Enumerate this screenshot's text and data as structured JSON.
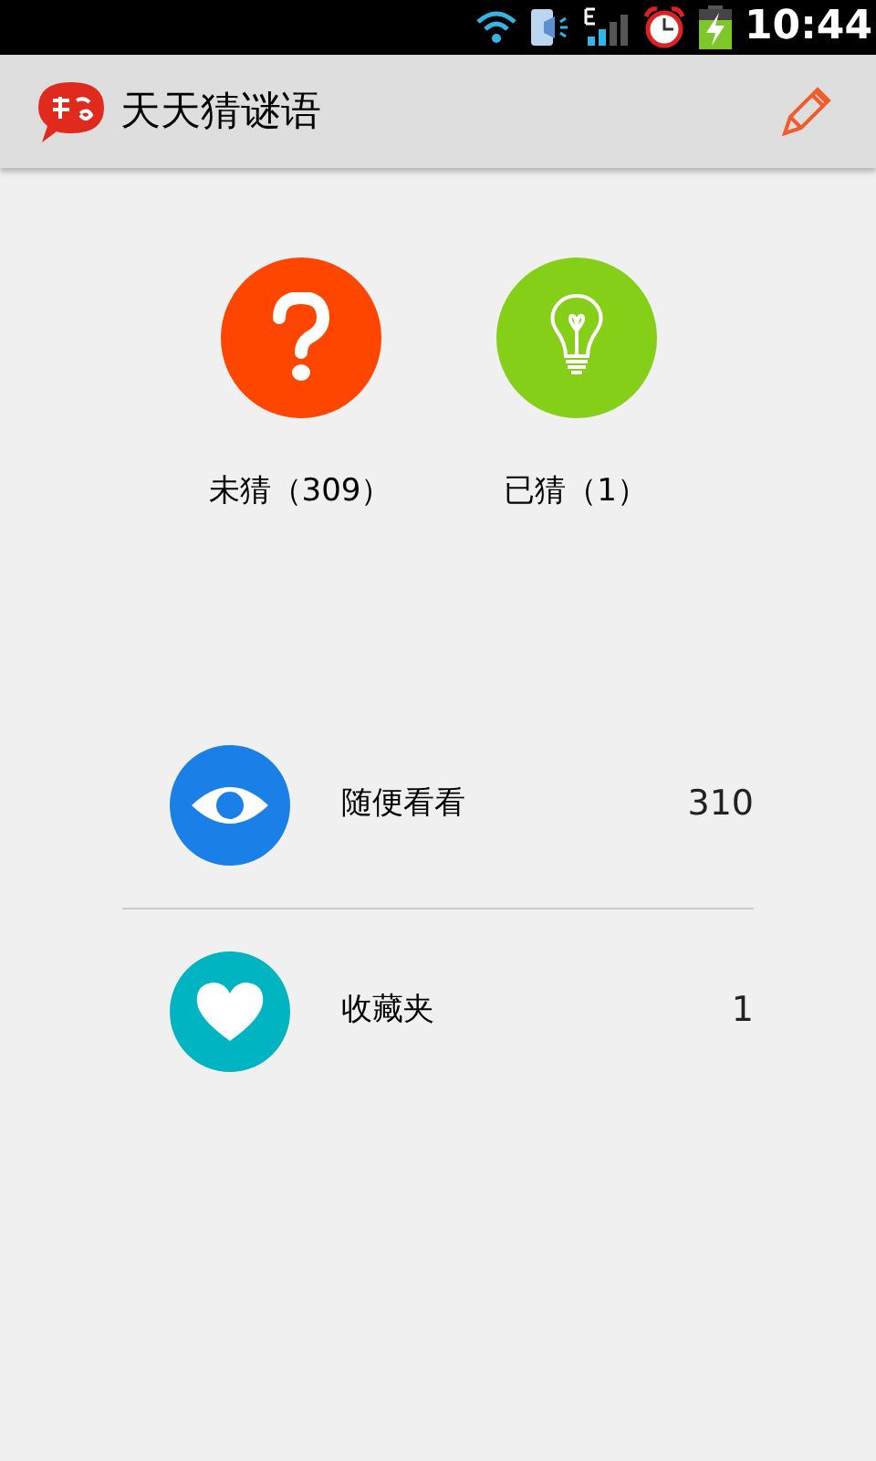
{
  "status_bar": {
    "time": "10:44"
  },
  "app_bar": {
    "title": "天天猜谜语"
  },
  "stats": [
    {
      "kind": "question",
      "color": "#fe4600",
      "label": "未猜（309）"
    },
    {
      "kind": "bulb",
      "color": "#86cf19",
      "label": "已猜（1）"
    }
  ],
  "menu": [
    {
      "kind": "eye",
      "color": "#1b7fe8",
      "label": "随便看看",
      "count": "310"
    },
    {
      "kind": "heart",
      "color": "#00b4c1",
      "label": "收藏夹",
      "count": "1"
    }
  ]
}
